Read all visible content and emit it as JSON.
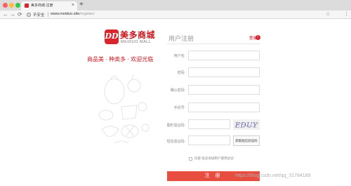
{
  "browser": {
    "tab": {
      "title": "美多商城-注册",
      "close_icon": "close-icon"
    },
    "address": {
      "security_label": "不安全",
      "url_host": "www.meiduo.site",
      "url_path": "/register/"
    }
  },
  "brand": {
    "logo_letters": "DD",
    "name_cn": "美多商城",
    "name_en": "MEIDUO MALL",
    "slogan": "商品美 · 种类多 · 欢迎光临",
    "accent_color": "#d9262c"
  },
  "form": {
    "title": "用户注册",
    "login_link": "登录",
    "fields": {
      "username": {
        "label": "用户名:"
      },
      "password": {
        "label": "密码:"
      },
      "password2": {
        "label": "确认密码:"
      },
      "mobile": {
        "label": "手机号:"
      },
      "image_code": {
        "label": "图形验证码:"
      },
      "sms_code": {
        "label": "短信验证码:"
      }
    },
    "captcha_text": "EDUY",
    "sms_button": "获取短信验证码",
    "agreement": "同意“美多商城用户使用协议”",
    "submit": "注 册",
    "submit_color": "#e84e40"
  },
  "watermark": "https://blog.csdn.net/qq_31784189"
}
